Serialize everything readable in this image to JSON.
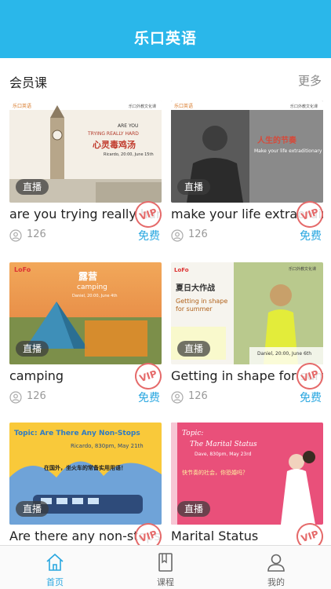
{
  "header": {
    "title": "乐口英语"
  },
  "section": {
    "title": "会员课",
    "more": "更多"
  },
  "courses": [
    {
      "title": "are you trying really hard",
      "views": "126",
      "price": "免费",
      "badge": "直播",
      "vip": "VIP",
      "poster": {
        "line1": "ARE YOU",
        "line2": "TRYING REALLY HARD",
        "line3": "心灵毒鸡汤",
        "line4": "Ricardo, 20:00, June 15th",
        "brand": "乐口英语",
        "tag": "乐口外教文化课"
      }
    },
    {
      "title": "make your life extraordinary",
      "views": "126",
      "price": "免费",
      "badge": "直播",
      "vip": "VIP",
      "poster": {
        "line1": "人生的节奏",
        "line2": "Make your life extraditionary",
        "brand": "乐口英语",
        "tag": "乐口外教文化课"
      }
    },
    {
      "title": "camping",
      "views": "126",
      "price": "免费",
      "badge": "直播",
      "vip": "VIP",
      "poster": {
        "line1": "露营",
        "line2": "camping",
        "line3": "Daniel, 20:00, June 4th",
        "brand": "LoFo"
      }
    },
    {
      "title": "Getting in shape for summer",
      "views": "126",
      "price": "免费",
      "badge": "直播",
      "vip": "VIP",
      "poster": {
        "line1": "夏日大作战",
        "line2": "Getting in shape",
        "line3": "for summer",
        "line4": "Daniel, 20:00, June 6th",
        "brand": "LoFo",
        "tag": "乐口外教文化课"
      }
    },
    {
      "title": "Are there any non-stops",
      "views": "126",
      "price": "免费",
      "badge": "直播",
      "vip": "VIP",
      "poster": {
        "line1": "Topic: Are There Any Non-Stops",
        "line2": "Ricardo, 830pm, May 21th",
        "line3": "在国外，坐火车的常备实用用语！"
      }
    },
    {
      "title": "Marital Status",
      "views": "126",
      "price": "免费",
      "badge": "直播",
      "vip": "VIP",
      "poster": {
        "line1": "Topic:",
        "line2": "The Marital Status",
        "line3": "Dave, 830pm, May 23rd",
        "line4": "快节奏的社会，你恐婚吗？"
      }
    }
  ],
  "tabs": [
    {
      "label": "首页",
      "icon": "home-icon",
      "active": true
    },
    {
      "label": "课程",
      "icon": "book-icon",
      "active": false
    },
    {
      "label": "我的",
      "icon": "profile-icon",
      "active": false
    }
  ],
  "colors": {
    "accent": "#2ab7ea",
    "price": "#2aa7e0",
    "vip": "#e56a6a"
  }
}
